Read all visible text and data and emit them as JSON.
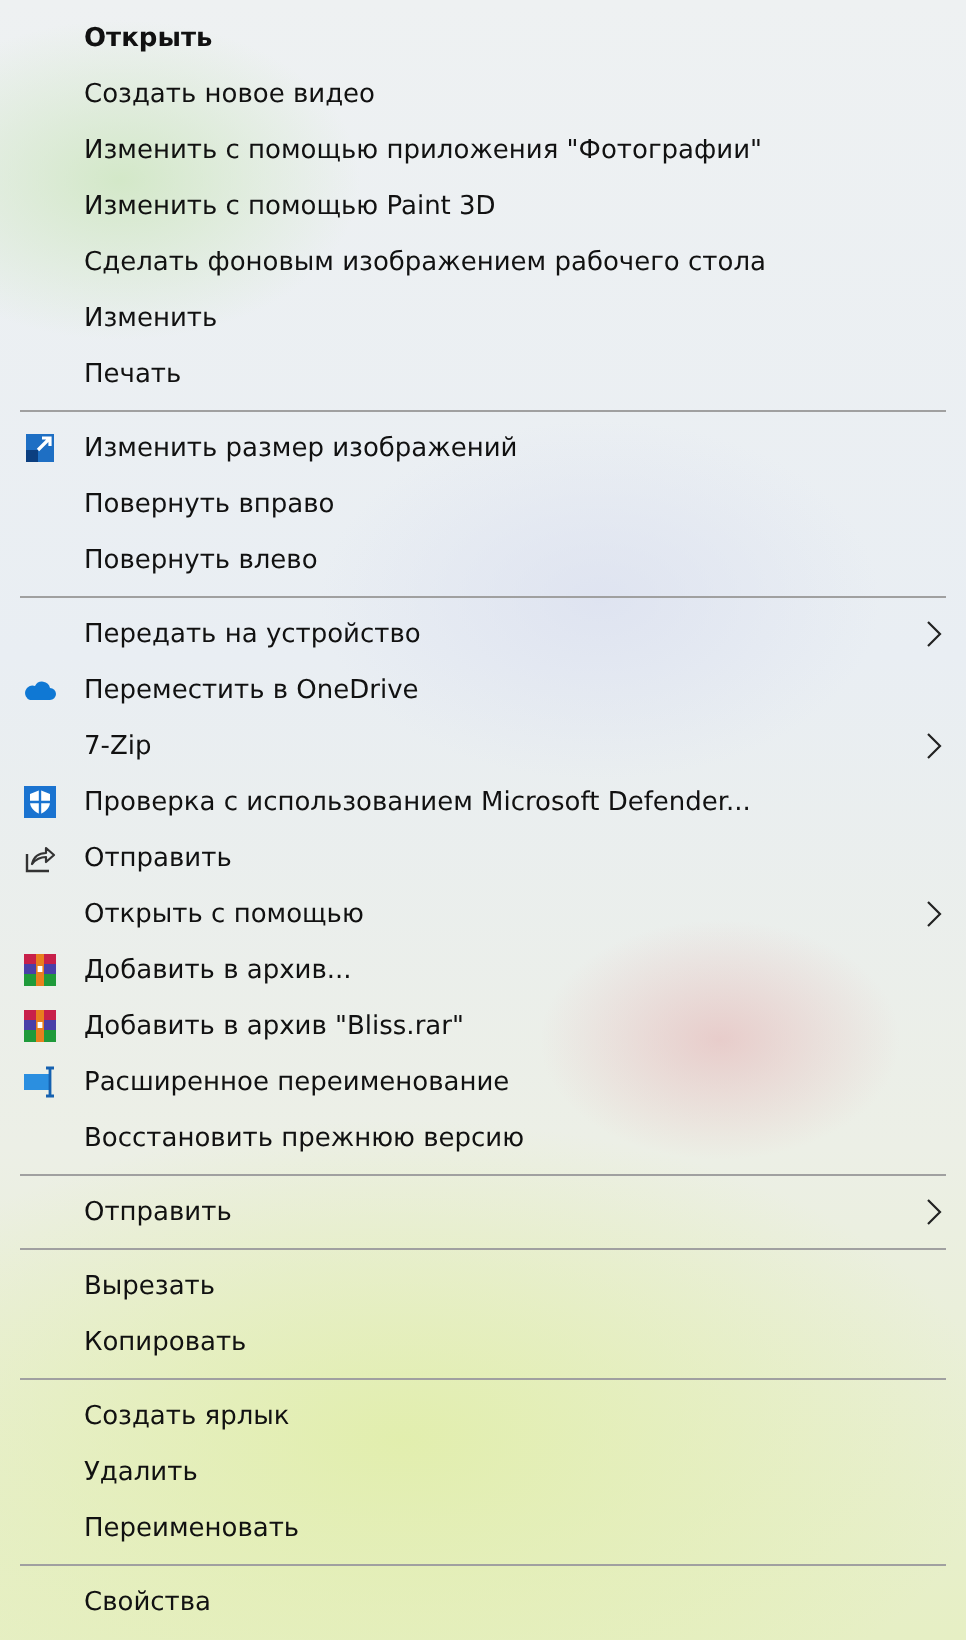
{
  "menu": {
    "groups": [
      {
        "items": [
          {
            "label": "Открыть",
            "kind": "plain",
            "default": true,
            "submenu": false
          },
          {
            "label": "Создать новое видео",
            "kind": "plain",
            "default": false,
            "submenu": false
          },
          {
            "label": "Изменить с помощью приложения \"Фотографии\"",
            "kind": "plain",
            "default": false,
            "submenu": false
          },
          {
            "label": "Изменить с помощью Paint 3D",
            "kind": "plain",
            "default": false,
            "submenu": false
          },
          {
            "label": "Сделать фоновым изображением рабочего стола",
            "kind": "plain",
            "default": false,
            "submenu": false
          },
          {
            "label": "Изменить",
            "kind": "plain",
            "default": false,
            "submenu": false
          },
          {
            "label": "Печать",
            "kind": "plain",
            "default": false,
            "submenu": false
          }
        ]
      },
      {
        "items": [
          {
            "label": "Изменить размер изображений",
            "kind": "resize",
            "default": false,
            "submenu": false
          },
          {
            "label": "Повернуть вправо",
            "kind": "plain",
            "default": false,
            "submenu": false
          },
          {
            "label": "Повернуть влево",
            "kind": "plain",
            "default": false,
            "submenu": false
          }
        ]
      },
      {
        "items": [
          {
            "label": "Передать на устройство",
            "kind": "plain",
            "default": false,
            "submenu": true
          },
          {
            "label": "Переместить в OneDrive",
            "kind": "cloud",
            "default": false,
            "submenu": false
          },
          {
            "label": "7-Zip",
            "kind": "plain",
            "default": false,
            "submenu": true
          },
          {
            "label": "Проверка с использованием Microsoft Defender...",
            "kind": "shield",
            "default": false,
            "submenu": false
          },
          {
            "label": "Отправить",
            "kind": "share",
            "default": false,
            "submenu": false
          },
          {
            "label": "Открыть с помощью",
            "kind": "plain",
            "default": false,
            "submenu": true
          },
          {
            "label": "Добавить в архив...",
            "kind": "archive",
            "default": false,
            "submenu": false
          },
          {
            "label": "Добавить в архив \"Bliss.rar\"",
            "kind": "archive",
            "default": false,
            "submenu": false
          },
          {
            "label": "Расширенное переименование",
            "kind": "rename",
            "default": false,
            "submenu": false
          },
          {
            "label": "Восстановить прежнюю версию",
            "kind": "plain",
            "default": false,
            "submenu": false
          }
        ]
      },
      {
        "items": [
          {
            "label": "Отправить",
            "kind": "plain",
            "default": false,
            "submenu": true
          }
        ]
      },
      {
        "items": [
          {
            "label": "Вырезать",
            "kind": "plain",
            "default": false,
            "submenu": false
          },
          {
            "label": "Копировать",
            "kind": "plain",
            "default": false,
            "submenu": false
          }
        ]
      },
      {
        "items": [
          {
            "label": "Создать ярлык",
            "kind": "plain",
            "default": false,
            "submenu": false
          },
          {
            "label": "Удалить",
            "kind": "plain",
            "default": false,
            "submenu": false
          },
          {
            "label": "Переименовать",
            "kind": "plain",
            "default": false,
            "submenu": false
          }
        ]
      },
      {
        "items": [
          {
            "label": "Свойства",
            "kind": "plain",
            "default": false,
            "submenu": false
          }
        ]
      }
    ]
  }
}
